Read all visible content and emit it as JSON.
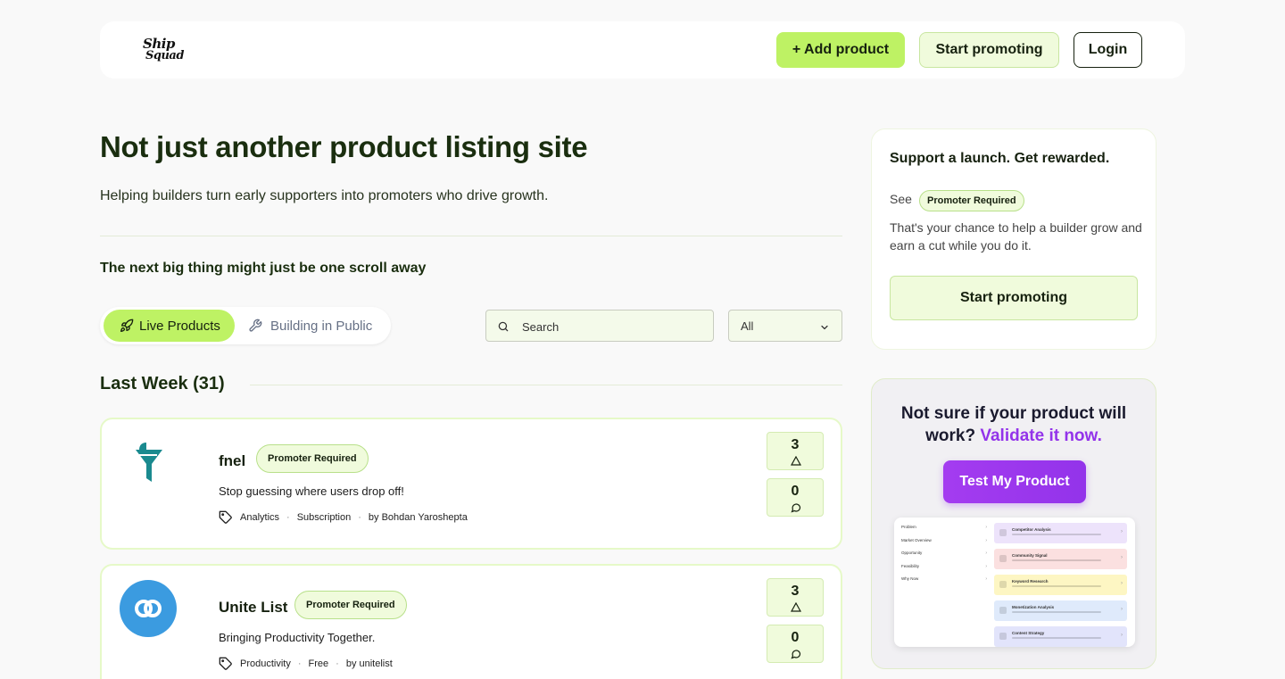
{
  "header": {
    "logo_line1": "Ship",
    "logo_line2": "Squad",
    "add_product": "+ Add product",
    "start_promoting": "Start promoting",
    "login": "Login"
  },
  "hero": {
    "title": "Not just another product listing site",
    "subtitle": "Helping builders turn early supporters into promoters who drive growth."
  },
  "tagline": "The next big thing might just be one scroll away",
  "tabs": [
    {
      "label": "Live Products",
      "icon": "rocket-icon",
      "active": true
    },
    {
      "label": "Building in Public",
      "icon": "wrench-icon",
      "active": false
    }
  ],
  "search": {
    "placeholder": "Search"
  },
  "filter": {
    "selected": "All"
  },
  "section": {
    "title": "Last Week (31)"
  },
  "products": [
    {
      "name": "fnel",
      "badge": "Promoter Required",
      "description": "Stop guessing where users drop off!",
      "tags": [
        "Analytics",
        "Subscription"
      ],
      "author": "by Bohdan Yaroshepta",
      "upvotes": "3",
      "comments": "0",
      "logo_color": "#1a8a8f"
    },
    {
      "name": "Unite List",
      "badge": "Promoter Required",
      "description": "Bringing Productivity Together.",
      "tags": [
        "Productivity",
        "Free"
      ],
      "author": "by unitelist",
      "upvotes": "3",
      "comments": "0",
      "logo_color": "#3b9be0"
    }
  ],
  "support_panel": {
    "title": "Support a launch. Get rewarded.",
    "see": "See",
    "badge": "Promoter Required",
    "text": "That's your chance to help a builder grow and earn a cut while you do it.",
    "button": "Start promoting"
  },
  "validate_panel": {
    "title_line1": "Not sure if your product will",
    "title_line2": "work?",
    "accent": "Validate it now.",
    "button": "Test My Product",
    "preview_left": [
      "Problem",
      "Market Overview",
      "Opportunity",
      "Feasibility",
      "Why Now"
    ],
    "preview_right": [
      {
        "title": "Competitor Analysis",
        "color": "#ede3fb"
      },
      {
        "title": "Community Signal",
        "color": "#fbe0e0"
      },
      {
        "title": "Keyword Research",
        "color": "#fdf6c3"
      },
      {
        "title": "Monetization Analysis",
        "color": "#dfeafb"
      },
      {
        "title": "Content Strategy",
        "color": "#e2e4fb"
      }
    ]
  },
  "colors": {
    "accent_lime": "#bef264",
    "accent_purple": "#9333ea"
  }
}
